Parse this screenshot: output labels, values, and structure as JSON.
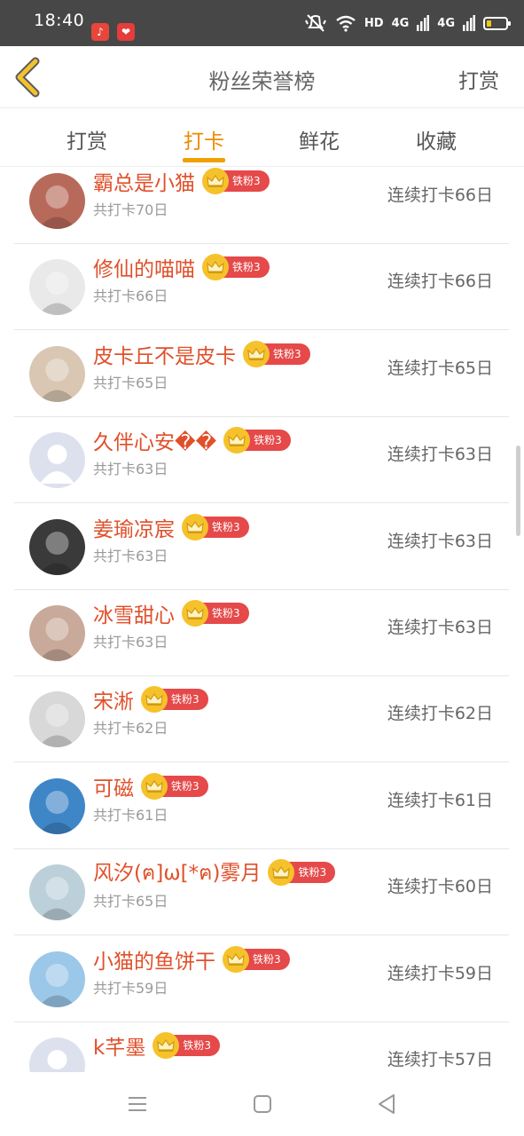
{
  "status_bar": {
    "time": "18:40",
    "network_label": "HD",
    "signal1_label": "4G",
    "signal2_label": "4G",
    "icons": [
      "music-app-icon",
      "heart-app-icon",
      "mute-icon",
      "wifi-icon",
      "signal-icon",
      "battery-icon"
    ]
  },
  "header": {
    "title": "粉丝荣誉榜",
    "action_label": "打赏",
    "back_icon": "chevron-left-icon",
    "accent": "#f0a000"
  },
  "tabs": [
    {
      "label": "打赏",
      "active": false
    },
    {
      "label": "打卡",
      "active": true
    },
    {
      "label": "鲜花",
      "active": false
    },
    {
      "label": "收藏",
      "active": false
    }
  ],
  "list": {
    "badge_label": "铁粉3",
    "items": [
      {
        "name": "霸总是小猫",
        "total": "共打卡70日",
        "streak": "连续打卡66日",
        "avatar": "photo-avatar",
        "avatar_color": "#b86a5a"
      },
      {
        "name": "修仙的喵喵",
        "total": "共打卡66日",
        "streak": "连续打卡66日",
        "avatar": "cat-sketch-avatar",
        "avatar_color": "#e9e9e9"
      },
      {
        "name": "皮卡丘不是皮卡",
        "total": "共打卡65日",
        "streak": "连续打卡65日",
        "avatar": "kitten-avatar",
        "avatar_color": "#d9c7b3"
      },
      {
        "name": "久伴心安��",
        "total": "共打卡63日",
        "streak": "连续打卡63日",
        "avatar": "default-avatar",
        "avatar_color": "#dde1ee"
      },
      {
        "name": "姜瑜凉宸",
        "total": "共打卡63日",
        "streak": "连续打卡63日",
        "avatar": "girl-avatar",
        "avatar_color": "#3a3a3a"
      },
      {
        "name": "冰雪甜心",
        "total": "共打卡63日",
        "streak": "连续打卡63日",
        "avatar": "baby-avatar",
        "avatar_color": "#c9a999"
      },
      {
        "name": "宋淅",
        "total": "共打卡62日",
        "streak": "连续打卡62日",
        "avatar": "ink-portrait-avatar",
        "avatar_color": "#d8d8d8"
      },
      {
        "name": "可磁",
        "total": "共打卡61日",
        "streak": "连续打卡61日",
        "avatar": "anime-cat-avatar",
        "avatar_color": "#3f86c7"
      },
      {
        "name": "风汐(ฅ]ω[*ฅ)雾月",
        "total": "共打卡65日",
        "streak": "连续打卡60日",
        "avatar": "anime-boy-avatar",
        "avatar_color": "#bcd0da"
      },
      {
        "name": "小猫的鱼饼干",
        "total": "共打卡59日",
        "streak": "连续打卡59日",
        "avatar": "anime-girl-avatar",
        "avatar_color": "#9bc7e8"
      },
      {
        "name": "k芊墨",
        "total": "",
        "streak": "连续打卡57日",
        "avatar": "default-avatar",
        "avatar_color": "#dde1ee"
      }
    ]
  },
  "nav_bar": {
    "icons": [
      "menu-icon",
      "home-icon",
      "back-triangle-icon"
    ]
  }
}
